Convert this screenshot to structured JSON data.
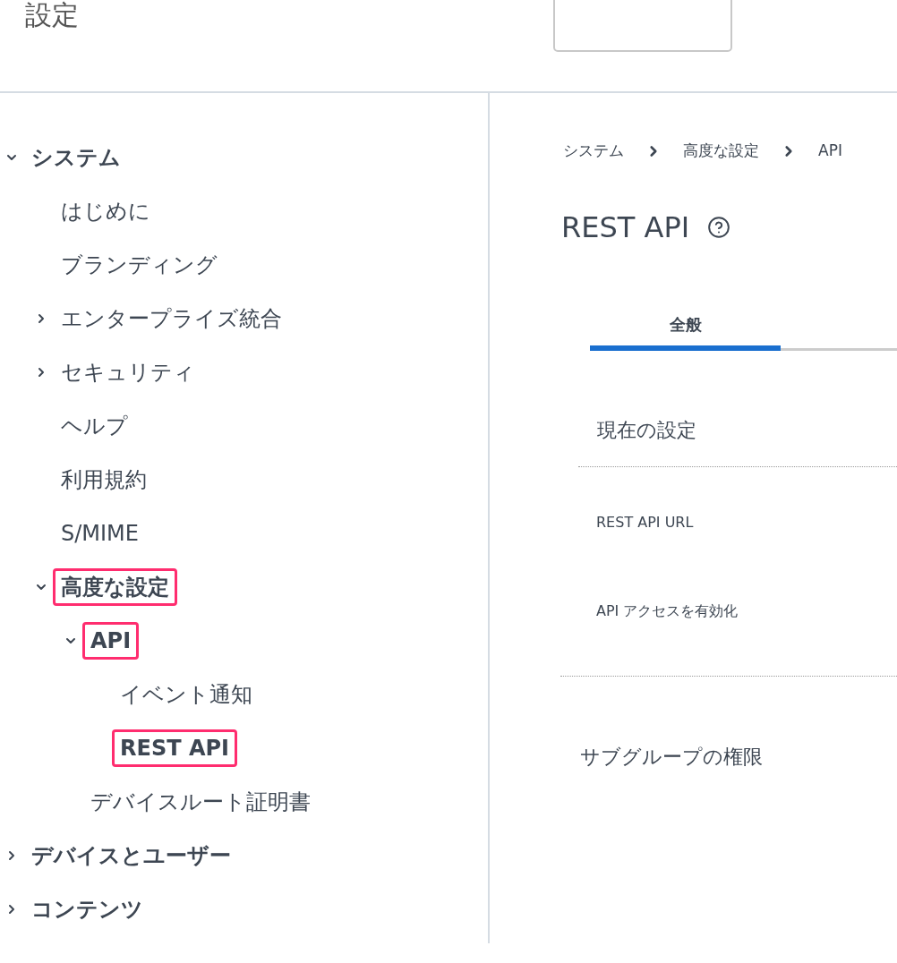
{
  "page_title": "設定",
  "sidebar": {
    "items": [
      {
        "label": "システム",
        "expanded": true,
        "highlighted": false,
        "children": [
          {
            "label": "はじめに",
            "highlighted": false
          },
          {
            "label": "ブランディング",
            "highlighted": false
          },
          {
            "label": "エンタープライズ統合",
            "expanded": false,
            "highlighted": false
          },
          {
            "label": "セキュリティ",
            "expanded": false,
            "highlighted": false
          },
          {
            "label": "ヘルプ",
            "highlighted": false
          },
          {
            "label": "利用規約",
            "highlighted": false
          },
          {
            "label": "S/MIME",
            "highlighted": false
          },
          {
            "label": "高度な設定",
            "expanded": true,
            "highlighted": true,
            "children": [
              {
                "label": "API",
                "expanded": true,
                "highlighted": true,
                "children": [
                  {
                    "label": "イベント通知",
                    "highlighted": false
                  },
                  {
                    "label": "REST API",
                    "highlighted": true
                  }
                ]
              },
              {
                "label": "デバイスルート証明書",
                "highlighted": false
              }
            ]
          }
        ]
      },
      {
        "label": "デバイスとユーザー",
        "expanded": false,
        "highlighted": false
      },
      {
        "label": "コンテンツ",
        "expanded": false,
        "highlighted": false
      }
    ]
  },
  "breadcrumb": [
    "システム",
    "高度な設定",
    "API"
  ],
  "title": "REST API",
  "tabs": [
    {
      "label": "全般",
      "selected": true
    }
  ],
  "section": {
    "title": "現在の設定",
    "fields": [
      "REST API URL",
      "API アクセスを有効化"
    ]
  },
  "subgroup_title": "サブグループの権限"
}
